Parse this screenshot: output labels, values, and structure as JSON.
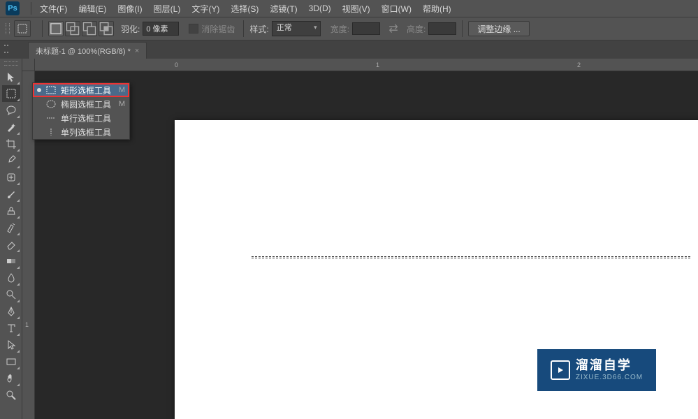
{
  "app": {
    "logo": "Ps"
  },
  "menu": {
    "file": "文件(F)",
    "edit": "编辑(E)",
    "image": "图像(I)",
    "layer": "图层(L)",
    "type": "文字(Y)",
    "select": "选择(S)",
    "filter": "滤镜(T)",
    "threed": "3D(D)",
    "view": "视图(V)",
    "window": "窗口(W)",
    "help": "帮助(H)"
  },
  "options": {
    "feather_label": "羽化:",
    "feather_value": "0 像素",
    "antialias": "消除锯齿",
    "style_label": "样式:",
    "style_value": "正常",
    "width_label": "宽度:",
    "height_label": "高度:",
    "refine": "调整边缘 ..."
  },
  "tab": {
    "title": "未标题-1 @ 100%(RGB/8) *",
    "close": "×"
  },
  "ruler_h": {
    "t0": "0",
    "t1": "1",
    "t2": "2"
  },
  "ruler_v": {
    "t1": "1"
  },
  "flyout": {
    "rect": "矩形选框工具",
    "ellipse": "椭圆选框工具",
    "row": "单行选框工具",
    "col": "单列选框工具",
    "shortcut_m": "M"
  },
  "watermark": {
    "line1": "溜溜自学",
    "line2": "ZIXUE.3D66.COM"
  }
}
